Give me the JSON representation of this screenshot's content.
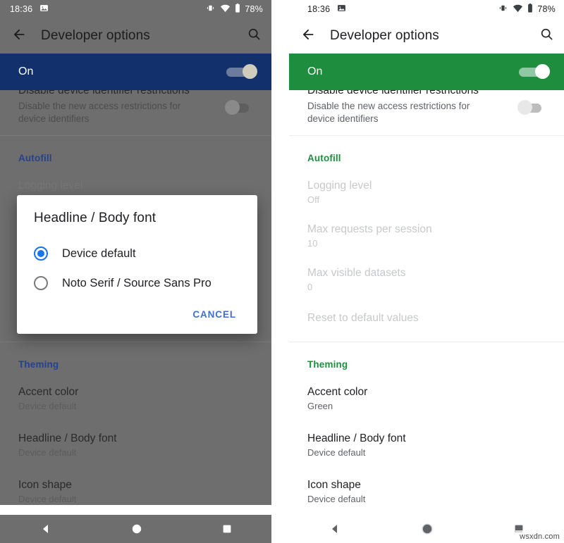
{
  "statusbar": {
    "time": "18:36",
    "battery_percent": "78%",
    "icons": [
      "image-icon",
      "vibrate-icon",
      "wifi-icon",
      "battery-icon"
    ]
  },
  "appbar": {
    "title": "Developer options",
    "back_icon": "back-arrow-icon",
    "search_icon": "search-icon"
  },
  "master_switch": {
    "label": "On",
    "state": "on"
  },
  "dev_identifier_row": {
    "title_cut": "Disable device identifier restrictions",
    "subtitle_line1": "Disable the new access restrictions for",
    "subtitle_line2": "device identifiers",
    "toggle_state": "off"
  },
  "autofill": {
    "header": "Autofill",
    "items": [
      {
        "title": "Logging level",
        "value": "Off"
      },
      {
        "title": "Max requests per session",
        "value": "10"
      },
      {
        "title": "Max visible datasets",
        "value": "0"
      },
      {
        "title": "Reset to default values",
        "value": ""
      }
    ]
  },
  "theming_left": {
    "header": "Theming",
    "items": [
      {
        "title": "Accent color",
        "value": "Device default"
      },
      {
        "title": "Headline / Body font",
        "value": "Device default"
      },
      {
        "title": "Icon shape",
        "value": "Device default"
      }
    ]
  },
  "theming_right": {
    "header": "Theming",
    "items": [
      {
        "title": "Accent color",
        "value": "Green"
      },
      {
        "title": "Headline / Body font",
        "value": "Device default"
      },
      {
        "title": "Icon shape",
        "value": "Device default"
      }
    ]
  },
  "dialog": {
    "title": "Headline / Body font",
    "options": [
      {
        "label": "Device default",
        "selected": true
      },
      {
        "label": "Noto Serif / Source Sans Pro",
        "selected": false
      }
    ],
    "cancel_label": "CANCEL"
  },
  "navbar": {
    "back_icon": "nav-back-triangle-icon",
    "home_icon": "nav-home-circle-icon",
    "recents_icon": "nav-recents-square-icon"
  },
  "watermark": {
    "text": "wsxdn.com"
  },
  "colors": {
    "left_accent": "#12306b",
    "right_accent": "#1e8e3e",
    "left_link": "#27418b",
    "right_link": "#1e8e3e",
    "dialog_radio": "#1a73e8",
    "dialog_cancel": "#3f6fd0",
    "scrim": "#6e6e6e"
  }
}
